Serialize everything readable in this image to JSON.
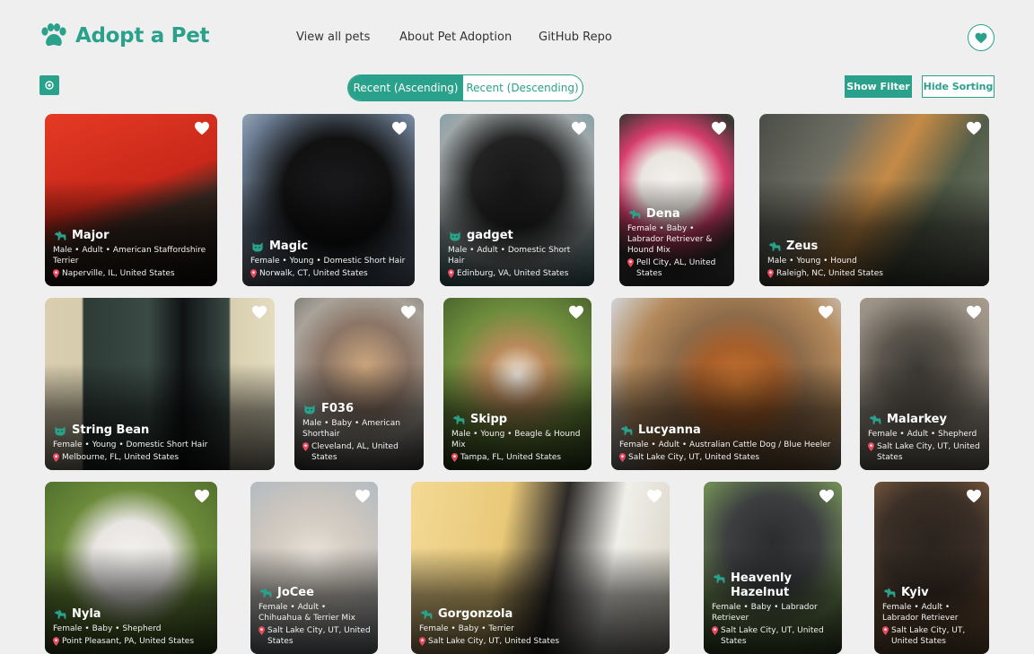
{
  "header": {
    "logo_text": "Adopt a Pet",
    "nav": [
      "View all pets",
      "About Pet Adoption",
      "GitHub Repo"
    ]
  },
  "toolbar": {
    "sort_ascending": "Recent (Ascending)",
    "sort_descending": "Recent (Descending)",
    "show_filter": "Show Filter",
    "hide_sorting": "Hide Sorting"
  },
  "colors": {
    "accent": "#2aa18b",
    "pin": "#e8495f"
  },
  "pets": [
    {
      "name": "Major",
      "species": "dog",
      "desc": "Male • Adult • American Staffordshire Terrier",
      "location": "Naperville, IL, United States",
      "bg": "linear-gradient(160deg,#e53a24 0%,#c9281a 45%,#3a2a22 60%,#1d1714 100%)"
    },
    {
      "name": "Magic",
      "species": "cat",
      "desc": "Female • Young • Domestic Short Hair",
      "location": "Norwalk, CT, United States",
      "bg": "radial-gradient(circle at 55% 45%,#1b1b1f 0%,#111 40%,#6d7f95 75%,#a9b6c6 100%)"
    },
    {
      "name": "gadget",
      "species": "cat",
      "desc": "Male • Adult • Domestic Short Hair",
      "location": "Edinburg, VA, United States",
      "bg": "radial-gradient(circle at 50% 40%,#171717 0%,#222 35%,#9fa7a9 65%,#5c9fa8 100%)"
    },
    {
      "name": "Dena",
      "species": "dog",
      "desc": "Female • Baby • Labrador Retriever & Hound Mix",
      "location": "Pell City, AL, United States",
      "bg": "radial-gradient(circle at 45% 40%,#f4f2ef 0%,#e9e4de 25%,#d63d6d 45%,#3a3533 70%,#6b6f75 100%)"
    },
    {
      "name": "Zeus",
      "species": "dog",
      "desc": "Male • Young • Hound",
      "location": "Raleigh, NC, United States",
      "bg": "linear-gradient(120deg,#4a4d47 0%,#6f6f64 30%,#c58a45 50%,#525d49 70%,#7c8072 100%)"
    },
    {
      "name": "String Bean",
      "species": "cat",
      "desc": "Female • Young • Domestic Short Hair",
      "location": "Melbourne, FL, United States",
      "bg": "linear-gradient(90deg,#d9cfb0 0%,#d6ccad 16%,#2d3a36 17%,#3b4a45 45%,#101214 60%,#3b4a45 80%,#d9cfb0 81%,#e4dcc0 100%)"
    },
    {
      "name": "F036",
      "species": "cat",
      "desc": "Male • Baby • American Shorthair",
      "location": "Cleveland, AL, United States",
      "bg": "radial-gradient(circle at 55% 40%,#cda67d 0%,#8b7566 35%,#a9a39a 60%,#5a5a57 100%)"
    },
    {
      "name": "Skipp",
      "species": "dog",
      "desc": "Male • Young • Beagle & Hound Mix",
      "location": "Tampa, FL, United States",
      "bg": "radial-gradient(circle at 50% 45%,#f3ece3 0%,#b98a5a 25%,#6f8d3c 55%,#3f5a2a 100%)"
    },
    {
      "name": "Lucyanna",
      "species": "dog",
      "desc": "Female • Adult • Australian Cattle Dog / Blue Heeler",
      "location": "Salt Lake City, UT, United States",
      "bg": "radial-gradient(circle at 55% 50%,#c9742f 0%,#a65e2a 25%,#8d6b4a 45%,#b48a5c 70%,#d2d6d9 100%)"
    },
    {
      "name": "Malarkey",
      "species": "dog",
      "desc": "Female • Adult • Shepherd",
      "location": "Salt Lake City, UT, United States",
      "bg": "radial-gradient(circle at 45% 40%,#3d3a36 0%,#5b554d 30%,#9a9185 60%,#b7ab98 100%)"
    },
    {
      "name": "Nyla",
      "species": "dog",
      "desc": "Female • Baby • Shepherd",
      "location": "Point Pleasant, PA, United States",
      "bg": "radial-gradient(circle at 50% 45%,#f5f3f0 0%,#e8e5e2 30%,#6c8a3a 55%,#4a6a2a 100%)"
    },
    {
      "name": "JoCee",
      "species": "dog",
      "desc": "Female • Adult • Chihuahua & Terrier Mix",
      "location": "Salt Lake City, UT, United States",
      "bg": "radial-gradient(circle at 50% 45%,#ebe6df 0%,#d6cfc5 30%,#c9c4be 55%,#a9b8c4 100%)"
    },
    {
      "name": "Gorgonzola",
      "species": "dog",
      "desc": "Female • Baby • Terrier",
      "location": "Salt Lake City, UT, United States",
      "bg": "linear-gradient(100deg,#f3d995 0%,#e9c978 35%,#2d2a28 55%,#f0efe9 75%,#d9d3c6 100%)"
    },
    {
      "name": "Heavenly Hazelnut",
      "species": "dog",
      "desc": "Female • Baby • Labrador Retriever",
      "location": "Salt Lake City, UT, United States",
      "bg": "radial-gradient(circle at 50% 35%,#2b2c2e 0%,#3c3e40 35%,#6f8a55 65%,#4f6a3a 100%)"
    },
    {
      "name": "Kyiv",
      "species": "dog",
      "desc": "Female • Adult • Labrador Retriever",
      "location": "Salt Lake City, UT, United States",
      "bg": "radial-gradient(circle at 50% 35%,#2a231e 0%,#3b2f27 40%,#7a5a3e 70%,#a9825a 100%)"
    }
  ]
}
